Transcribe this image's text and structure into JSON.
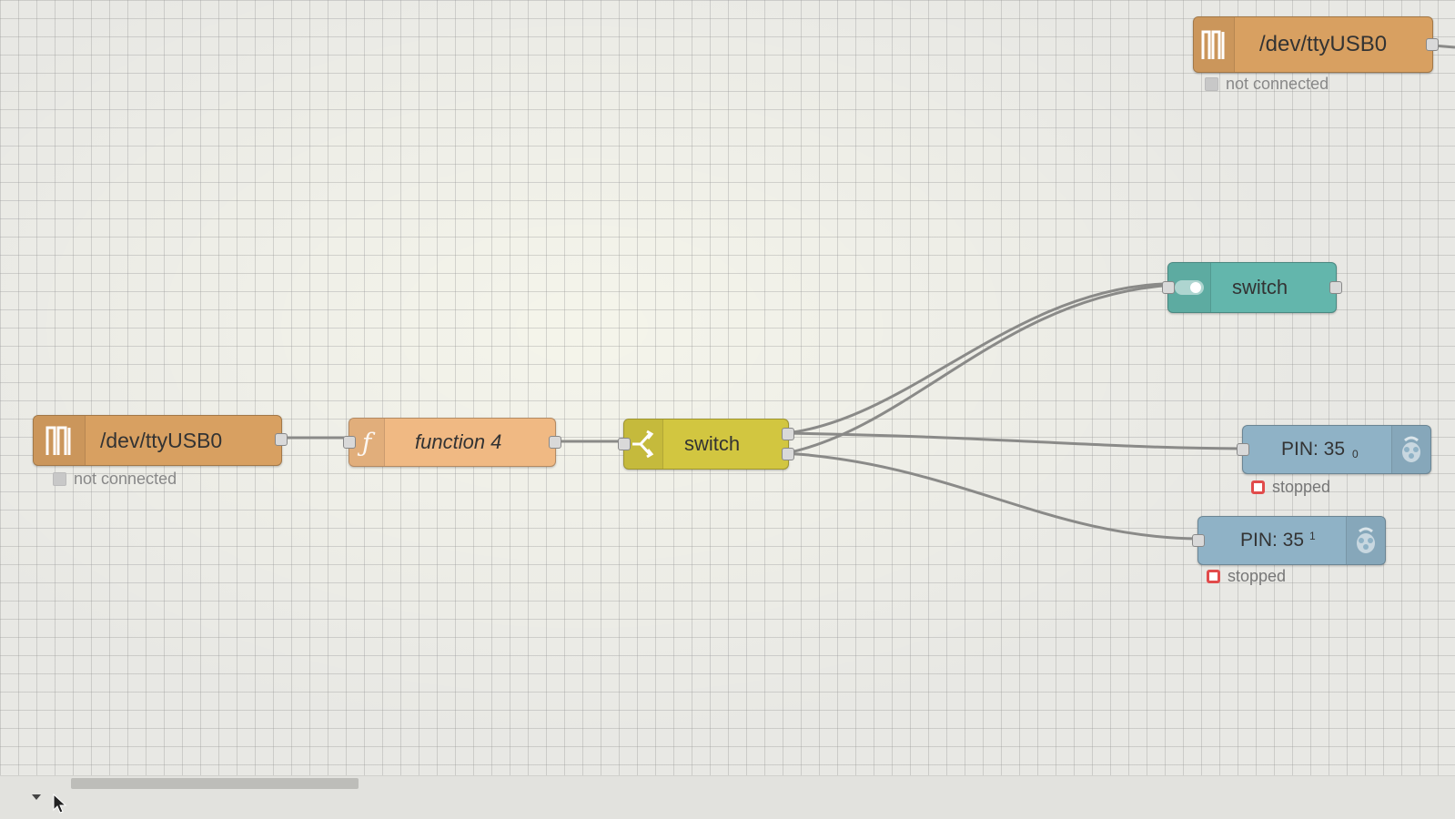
{
  "nodes": {
    "serial_top": {
      "label": "/dev/ttyUSB0",
      "status": "not connected"
    },
    "serial_left": {
      "label": "/dev/ttyUSB0",
      "status": "not connected"
    },
    "function": {
      "label": "function 4"
    },
    "switch_router": {
      "label": "switch"
    },
    "dashboard_switch": {
      "label": "switch"
    },
    "pin_out_0": {
      "label": "PIN: 35",
      "sub": "0",
      "status": "stopped"
    },
    "pin_out_1": {
      "label": "PIN: 35",
      "sub": "1",
      "status": "stopped"
    }
  },
  "icons": {
    "serial": "serial-wave-icon",
    "function": "function-icon",
    "switch": "switch-branch-icon",
    "toggle": "toggle-icon",
    "raspberry": "raspberry-pi-icon"
  },
  "colors": {
    "serial": "#d8a061",
    "function": "#f0b983",
    "switch": "#d2c640",
    "dashboard": "#63b6ac",
    "rpi": "#8fb2c6",
    "status_stopped": "#e14b4b"
  }
}
